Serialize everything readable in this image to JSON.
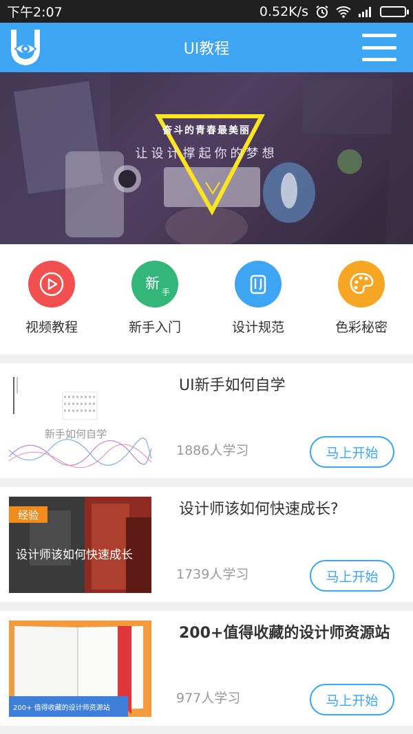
{
  "status_bar": {
    "time": "下午2:07",
    "speed": "0.52K/s"
  },
  "app_bar": {
    "title": "UI教程"
  },
  "banner": {
    "line1": "奋斗的青春最美丽",
    "line2": "让设计撑起你的梦想"
  },
  "categories": [
    {
      "label": "视频教程",
      "color": "#f24f4f",
      "icon": "play-icon"
    },
    {
      "label": "新手入门",
      "color": "#33b67a",
      "icon": "newbie-icon",
      "glyph": "新",
      "sub_glyph": "手"
    },
    {
      "label": "设计规范",
      "color": "#3ea4f4",
      "icon": "pencil-ruler-icon"
    },
    {
      "label": "色彩秘密",
      "color": "#f5a623",
      "icon": "palette-icon"
    }
  ],
  "courses": [
    {
      "title": "UI新手如何自学",
      "learners": "1886人学习",
      "button": "马上开始",
      "thumb_caption": "新手如何自学"
    },
    {
      "title": "设计师该如何快速成长?",
      "learners": "1739人学习",
      "button": "马上开始",
      "thumb_caption": "设计师该如何快速成长",
      "badge": "经验"
    },
    {
      "title": "200+值得收藏的设计师资源站",
      "learners": "977人学习",
      "button": "马上开始",
      "thumb_caption": "200+ 值得收藏的设计师资源站"
    }
  ]
}
